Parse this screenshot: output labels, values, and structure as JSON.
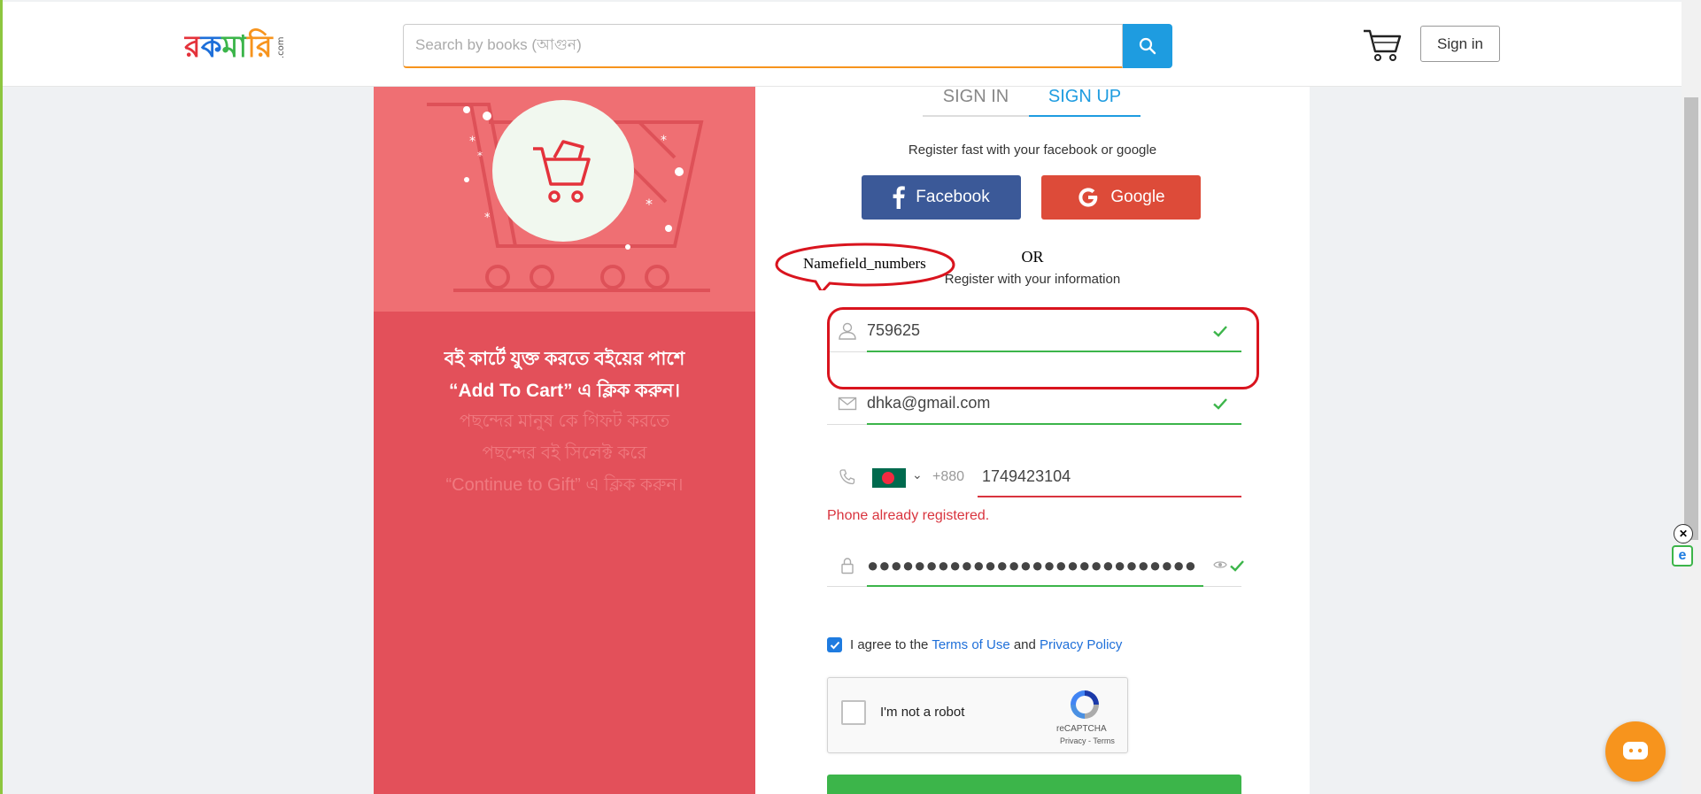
{
  "header": {
    "logo_text": "রকমারি.com",
    "search_placeholder": "Search by books (আগুন)",
    "signin_label": "Sign in"
  },
  "promo": {
    "line1": "বই কার্টে যুক্ত করতে বইয়ের পাশে",
    "line2": "“Add To Cart” এ ক্লিক করুন।",
    "faded1": "পছন্দের মানুষ কে গিফট করতে",
    "faded2": "পছন্দের বই সিলেক্ট করে",
    "faded3": "“Continue to Gift” এ ক্লিক করুন।"
  },
  "auth": {
    "tab_signin": "SIGN IN",
    "tab_signup": "SIGN UP",
    "register_fast": "Register fast with your facebook or google",
    "facebook_label": "Facebook",
    "google_label": "Google",
    "or_text": "OR",
    "register_info": "Register with your information"
  },
  "form": {
    "name_value": "759625",
    "email_value": "dhka@gmail.com",
    "dial_code": "+880",
    "phone_value": "1749423104",
    "phone_error": "Phone already registered.",
    "password_mask": "●●●●●●●●●●●●●●●●●●●●●●●●●●●●●●●●●●●●",
    "agree_prefix": "I agree to the",
    "terms_link": "Terms of Use",
    "agree_and": "and",
    "privacy_link": "Privacy Policy",
    "agree_checked": true
  },
  "recaptcha": {
    "label": "I'm not a robot",
    "brand": "reCAPTCHA",
    "terms": "Privacy - Terms"
  },
  "annotation": {
    "label": "Namefield_numbers"
  },
  "colors": {
    "accent": "#1e9ce0",
    "brand_orange": "#f7941d",
    "valid": "#3cb54a",
    "error": "#d9343e",
    "facebook": "#3b5998",
    "google": "#dd4b39",
    "promo_red": "#e3505a"
  }
}
